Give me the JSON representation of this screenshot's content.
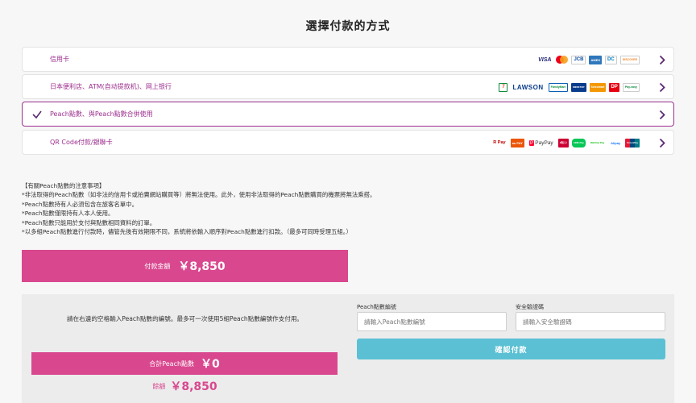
{
  "page_title": "選擇付款的方式",
  "methods": [
    {
      "label": "信用卡",
      "logos": [
        "VISA",
        "MC",
        "JCB",
        "AMEX",
        "DC",
        "DISCOVER"
      ]
    },
    {
      "label": "日本便利店、ATM(自动提款机)、网上银行",
      "logos": [
        "7",
        "LAWSON",
        "FamilyMart",
        "MINISTOP",
        "Seicomart",
        "DP",
        "Pay-easy"
      ]
    },
    {
      "label": "Peach點數、與Peach點數合併使用"
    },
    {
      "label": "QR Code付款/銀聯卡",
      "logos": [
        "R Pay",
        "au PAY",
        "PayPay",
        "d払い",
        "LINE Pay",
        "WeChat Pay",
        "Alipay",
        "UnionPay"
      ]
    }
  ],
  "notes": [
    "【有關Peach點數的注意事項】",
    "*非法取得的Peach點數（如非法的信用卡或拍賣網站購買等）將無法使用。此外，使用非法取得的Peach點數購買的機票將無法乘搭。",
    "*Peach點數持有人必須包含在旅客名單中。",
    "*Peach點數僅限持有人本人使用。",
    "*Peach點數只能用於支付與點數相同資料的訂單。",
    "*以多組Peach點數進行付款時，儘管先後有效期限不同，系統將依輸入順序對Peach點數進行扣款。（最多可同時受理五組。）"
  ],
  "payment": {
    "label": "付款金額",
    "amount": "￥8,850"
  },
  "points_panel": {
    "instruction": "請在右邊的空格輸入Peach點數的編號。最多可一次使用5組Peach點數編號作支付用。",
    "total_label": "合計Peach點數",
    "total_amount": "￥0",
    "remain_label": "餘額",
    "remain_amount": "￥8,850",
    "number_label": "Peach點數編號",
    "number_placeholder": "請輸入Peach點數編號",
    "code_label": "安全驗證碼",
    "code_placeholder": "請輸入安全驗證碼",
    "confirm_label": "確認付款"
  },
  "colors": {
    "brand": "#9c2f8e",
    "pink": "#d9488f",
    "confirm": "#5bc0d4"
  }
}
